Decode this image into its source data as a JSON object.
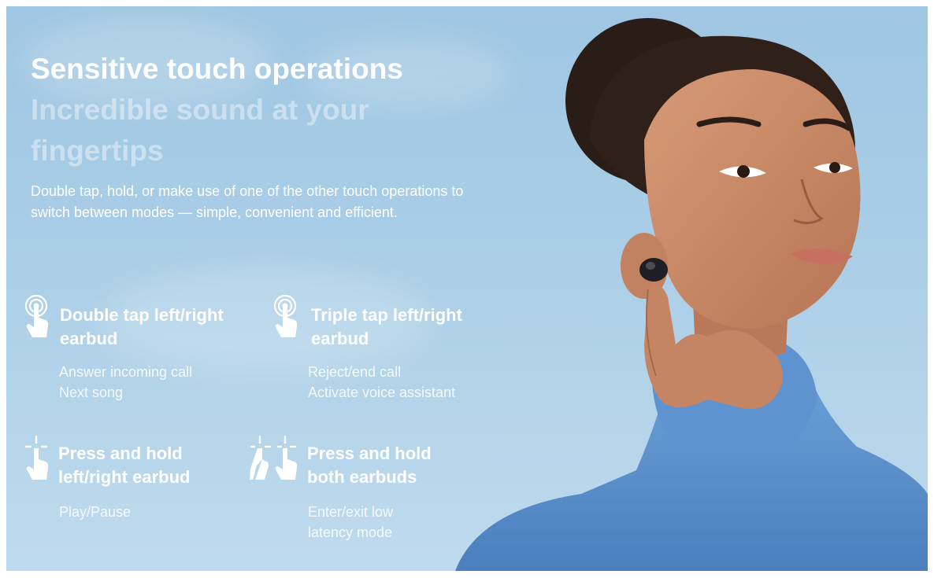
{
  "headline": {
    "line1": "Sensitive touch operations",
    "line2": "Incredible sound at your",
    "line3": "fingertips"
  },
  "description": "Double tap, hold, or make use of one of the other touch operations to switch between modes — simple, convenient and efficient.",
  "features": [
    {
      "icon": "single-tap-icon",
      "title_line1": "Double tap left/right",
      "title_line2": "earbud",
      "actions": [
        "Answer incoming call",
        "Next song"
      ]
    },
    {
      "icon": "single-tap-icon",
      "title_line1": "Triple tap left/right",
      "title_line2": "earbud",
      "actions": [
        "Reject/end call",
        "Activate voice assistant"
      ]
    },
    {
      "icon": "press-hold-icon",
      "title_line1": "Press and hold",
      "title_line2": "left/right earbud",
      "actions": [
        "Play/Pause"
      ]
    },
    {
      "icon": "two-hand-press-icon",
      "title_line1": "Press and hold",
      "title_line2": "both earbuds",
      "actions": [
        "Enter/exit low",
        "latency mode"
      ]
    }
  ],
  "colors": {
    "sky_top": "#9fc6e2",
    "sky_bottom": "#bfdaee",
    "text": "#ffffff",
    "sweater": "#5b8fc9",
    "earbud": "#1e1f24"
  }
}
